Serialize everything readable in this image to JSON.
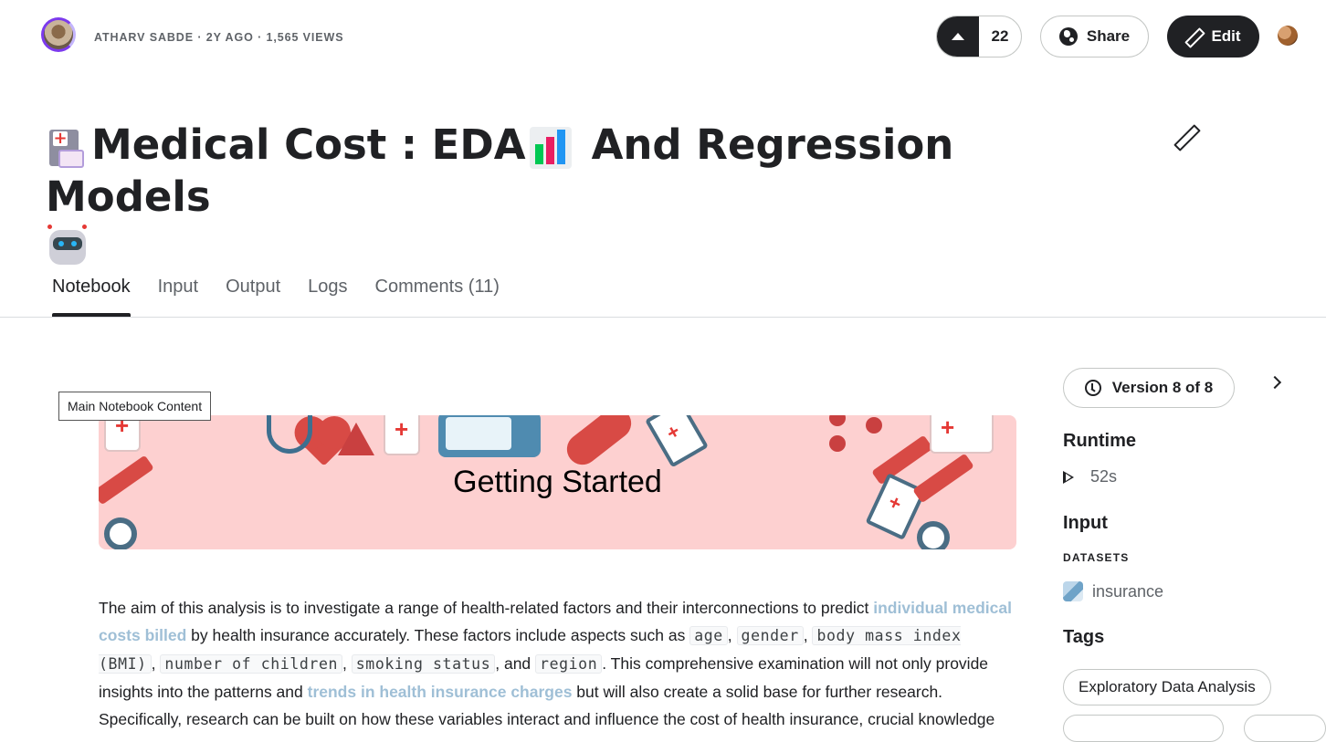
{
  "header": {
    "author_meta": "ATHARV SABDE · 2Y AGO · 1,565 VIEWS",
    "vote_count": "22",
    "share_label": "Share",
    "edit_label": "Edit"
  },
  "notebook": {
    "title": "Medical Cost : EDA",
    "title_part2": "And Regression Models"
  },
  "tabs": [
    {
      "label": "Notebook",
      "active": true
    },
    {
      "label": "Input"
    },
    {
      "label": "Output"
    },
    {
      "label": "Logs"
    },
    {
      "label": "Comments (11)"
    }
  ],
  "main": {
    "tooltip": "Main Notebook Content",
    "banner_title": "Getting Started",
    "para": {
      "t1": "The aim of this analysis is to investigate a range of health-related factors and their interconnections to predict ",
      "hl1": "individual medical costs billed",
      "t2": " by health insurance accurately. These factors include aspects such as ",
      "c1": "age",
      "s1": ", ",
      "c2": "gender",
      "s2": ", ",
      "c3": "body mass index (BMI)",
      "s3": ", ",
      "c4": "number of children",
      "s4": ", ",
      "c5": "smoking status",
      "s5": ", and ",
      "c6": "region",
      "t3": ". This comprehensive examination will not only provide insights into the patterns and ",
      "hl2": "trends in health insurance charges",
      "t4": " but will also create a solid base for further research. Specifically, research can be built on how these variables interact and influence the cost of health insurance, crucial knowledge"
    }
  },
  "sidebar": {
    "version_label": "Version 8 of 8",
    "runtime_heading": "Runtime",
    "runtime_value": "52s",
    "input_heading": "Input",
    "datasets_label": "DATASETS",
    "dataset_name": "insurance",
    "tags_heading": "Tags",
    "tag_1": "Exploratory Data Analysis"
  },
  "colors": {
    "accent_dark": "#202124",
    "banner_bg": "#fdd0d0",
    "link_highlight": "#9fbfd6"
  }
}
